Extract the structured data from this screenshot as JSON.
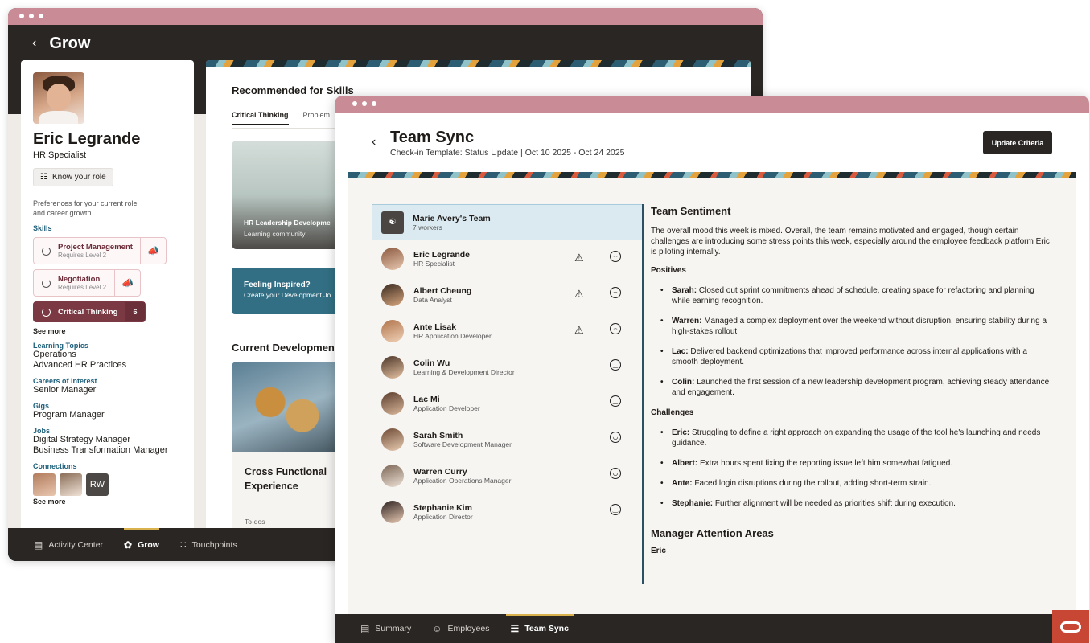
{
  "grow": {
    "title": "Grow",
    "profile": {
      "name": "Eric Legrande",
      "role": "HR Specialist",
      "know_role": "Know your role",
      "prefs_line1": "Preferences for your current role",
      "prefs_line2": "and career growth",
      "skills_heading": "Skills",
      "skills": [
        {
          "name": "Project Management",
          "sub": "Requires Level 2"
        },
        {
          "name": "Negotiation",
          "sub": "Requires Level 2"
        }
      ],
      "active_skill": {
        "name": "Critical Thinking",
        "count": "6"
      },
      "see_more": "See more",
      "learning_topics_heading": "Learning Topics",
      "learning_topics": [
        "Operations",
        "Advanced HR Practices"
      ],
      "careers_heading": "Careers of Interest",
      "careers": [
        "Senior Manager"
      ],
      "gigs_heading": "Gigs",
      "gigs": [
        "Program Manager"
      ],
      "jobs_heading": "Jobs",
      "jobs": [
        "Digital Strategy Manager",
        "Business Transformation Manager"
      ],
      "connections_heading": "Connections",
      "connection_initials": "RW",
      "see_more_2": "See more"
    },
    "main": {
      "recommended": "Recommended for Skills",
      "tabs": [
        "Critical Thinking",
        "Problem"
      ],
      "hr_card_title": "HR Leadership Developme",
      "hr_card_sub": "Learning community",
      "inspire_title": "Feeling Inspired?",
      "inspire_sub": "Create your Development Jo",
      "current_dev": "Current Developmen",
      "cf_title_1": "Cross Functional",
      "cf_title_2": "Experience",
      "todos": "To-dos"
    },
    "nav": [
      {
        "label": "Activity Center",
        "icon": "activity-center-icon"
      },
      {
        "label": "Grow",
        "icon": "grow-icon"
      },
      {
        "label": "Touchpoints",
        "icon": "touchpoints-icon"
      }
    ]
  },
  "teamsync": {
    "title": "Team Sync",
    "subtitle": "Check-in Template: Status Update | Oct 10 2025 - Oct 24 2025",
    "update_button": "Update Criteria",
    "team": {
      "name": "Marie Avery's Team",
      "count": "7 workers"
    },
    "members": [
      {
        "name": "Eric Legrande",
        "role": "HR Specialist",
        "warning": true,
        "mood": "sad"
      },
      {
        "name": "Albert Cheung",
        "role": "Data Analyst",
        "warning": true,
        "mood": "neutral"
      },
      {
        "name": "Ante Lisak",
        "role": "HR Application Developer",
        "warning": true,
        "mood": "sad"
      },
      {
        "name": "Colin Wu",
        "role": "Learning & Development Director",
        "warning": false,
        "mood": "happy"
      },
      {
        "name": "Lac Mi",
        "role": "Application Developer",
        "warning": false,
        "mood": "happy"
      },
      {
        "name": "Sarah Smith",
        "role": "Software Development Manager",
        "warning": false,
        "mood": "very-happy"
      },
      {
        "name": "Warren Curry",
        "role": "Application Operations Manager",
        "warning": false,
        "mood": "very-happy"
      },
      {
        "name": "Stephanie Kim",
        "role": "Application Director",
        "warning": false,
        "mood": "happy"
      }
    ],
    "sentiment": {
      "heading": "Team Sentiment",
      "intro": "The overall mood this week is mixed. Overall, the team remains motivated and engaged, though certain challenges are introducing some stress points this week, especially around the employee feedback platform Eric is piloting internally.",
      "positives_heading": "Positives",
      "positives": [
        {
          "who": "Sarah:",
          "text": " Closed out sprint commitments ahead of schedule, creating space for refactoring and planning while earning recognition."
        },
        {
          "who": "Warren:",
          "text": " Managed a complex deployment over the weekend without disruption, ensuring stability during a high-stakes rollout."
        },
        {
          "who": "Lac:",
          "text": " Delivered backend optimizations that improved performance across internal applications with a smooth deployment."
        },
        {
          "who": "Colin:",
          "text": " Launched the first session of a new leadership development program, achieving steady attendance and engagement."
        }
      ],
      "challenges_heading": "Challenges",
      "challenges": [
        {
          "who": "Eric:",
          "text": " Struggling to define a right approach on expanding the usage of the tool he's launching and needs guidance."
        },
        {
          "who": "Albert:",
          "text": " Extra hours spent fixing the reporting issue left him somewhat fatigued."
        },
        {
          "who": "Ante:",
          "text": " Faced login disruptions during the rollout, adding short-term strain."
        },
        {
          "who": "Stephanie:",
          "text": " Further alignment will be needed as priorities shift during execution."
        }
      ],
      "attention_heading": "Manager Attention Areas",
      "attention_name": "Eric"
    },
    "nav": [
      {
        "label": "Summary",
        "icon": "summary-icon"
      },
      {
        "label": "Employees",
        "icon": "employees-icon"
      },
      {
        "label": "Team Sync",
        "icon": "team-sync-icon"
      }
    ]
  },
  "colors": {
    "titlebar": "#c98c96",
    "dark": "#2a2624",
    "accent": "#7b3943",
    "teal": "#336f84",
    "oracle": "#c74634"
  }
}
